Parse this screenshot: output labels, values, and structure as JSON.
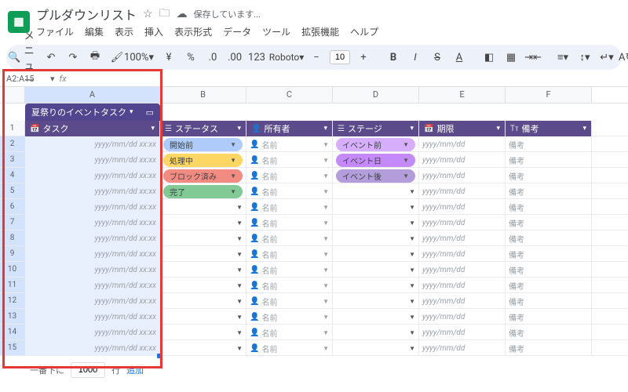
{
  "doc": {
    "title": "プルダウンリスト",
    "saving": "保存しています..."
  },
  "menu": [
    "ファイル",
    "編集",
    "表示",
    "挿入",
    "表示形式",
    "データ",
    "ツール",
    "拡張機能",
    "ヘルプ"
  ],
  "toolbar": {
    "menu": "メニュー",
    "zoom": "100%",
    "font": "Roboto",
    "size": "10"
  },
  "namebox": {
    "ref": "A2:A15"
  },
  "cols": [
    "A",
    "B",
    "C",
    "D",
    "E",
    "F"
  ],
  "table_title": "夏祭りのイベントタスク",
  "headers": {
    "task": "タスク",
    "status": "ステータス",
    "owner": "所有者",
    "stage": "ステージ",
    "due": "期限",
    "notes": "備考"
  },
  "placeholder": {
    "task": "yyyy/mm/dd xx:xx",
    "owner": "名前",
    "date": "yyyy/mm/dd",
    "note": "備考"
  },
  "status_chips": [
    {
      "label": "開始前",
      "cls": "c-blue"
    },
    {
      "label": "処理中",
      "cls": "c-yellow"
    },
    {
      "label": "ブロック済み",
      "cls": "c-red"
    },
    {
      "label": "完了",
      "cls": "c-green"
    }
  ],
  "stage_chips": [
    {
      "label": "イベント前",
      "cls": "c-lpurp"
    },
    {
      "label": "イベント日",
      "cls": "c-purp"
    },
    {
      "label": "イベント後",
      "cls": "c-dpurp"
    }
  ],
  "row_nums": [
    1,
    2,
    3,
    4,
    5,
    6,
    7,
    8,
    9,
    10,
    11,
    12,
    13,
    14,
    15
  ],
  "addrow": {
    "prefix": "一番下に",
    "count": "1000",
    "suffix": "行",
    "action": "追加"
  },
  "chart_data": null
}
